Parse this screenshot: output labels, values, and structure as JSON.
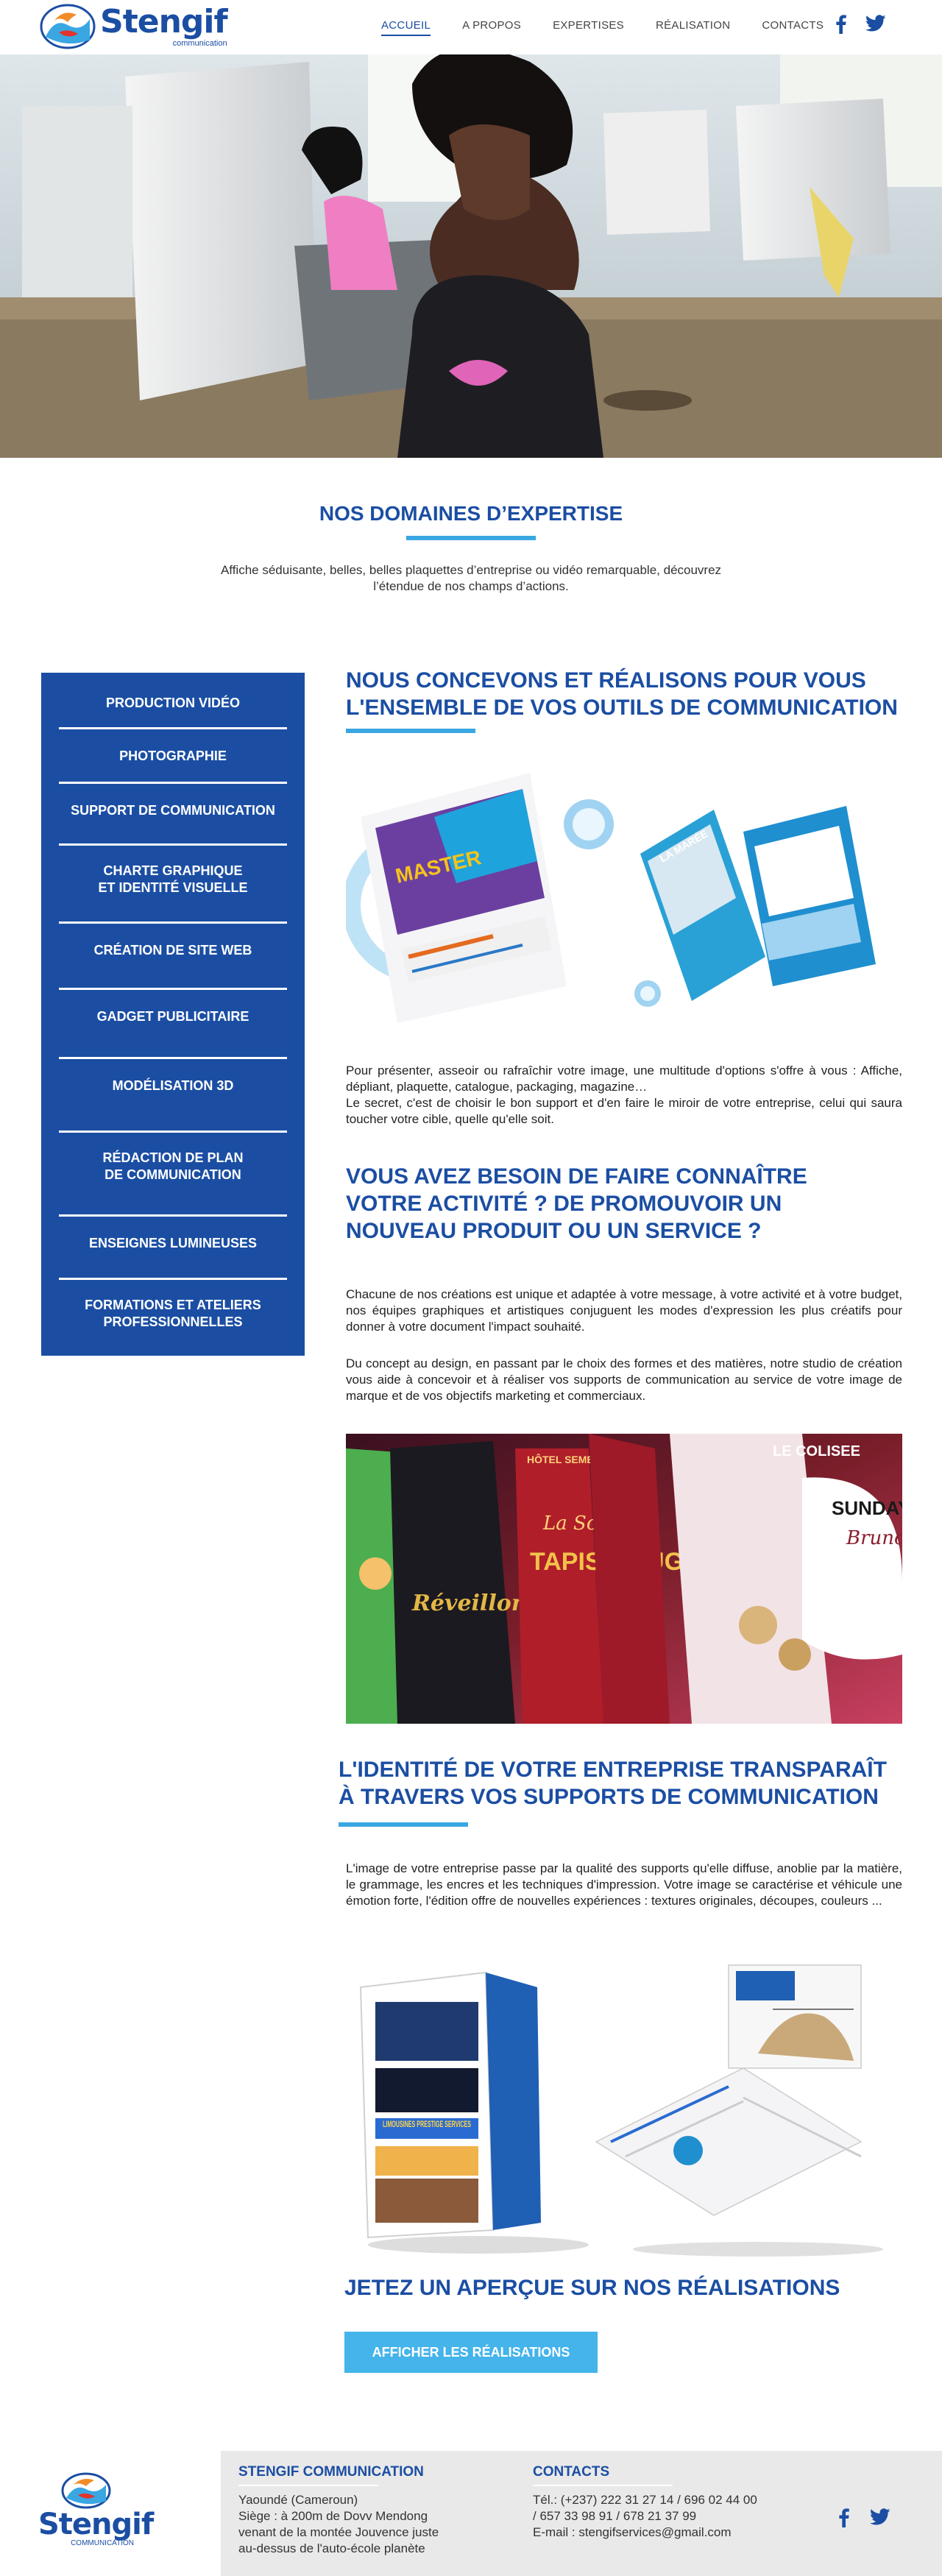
{
  "header": {
    "logo_name": "Stengif",
    "logo_sub": "communication",
    "nav": [
      {
        "label": "ACCUEIL",
        "active": true
      },
      {
        "label": "A PROPOS",
        "active": false
      },
      {
        "label": "EXPERTISES",
        "active": false
      },
      {
        "label": "RÉALISATION",
        "active": false
      },
      {
        "label": "CONTACTS",
        "active": false
      }
    ],
    "social": [
      "facebook-icon",
      "twitter-icon"
    ]
  },
  "expertise": {
    "title": "NOS DOMAINES D’EXPERTISE",
    "intro": "Affiche séduisante, belles, belles plaquettes d’entreprise ou vidéo remarquable, découvrez l’étendue de nos champs d’actions."
  },
  "sidebar": {
    "items": [
      "PRODUCTION VIDÉO",
      "PHOTOGRAPHIE",
      "SUPPORT DE COMMUNICATION",
      "CHARTE GRAPHIQUE\nET IDENTITÉ VISUELLE",
      "CRÉATION DE SITE WEB",
      "GADGET PUBLICITAIRE",
      "MODÉLISATION 3D",
      "RÉDACTION DE PLAN\nDE COMMUNICATION",
      "ENSEIGNES LUMINEUSES",
      "FORMATIONS ET ATELIERS\nPROFESSIONNELLES"
    ]
  },
  "content": {
    "h1": "NOUS CONCEVONS ET RÉALISONS POUR VOUS L'ENSEMBLE DE VOS OUTILS DE COMMUNICATION",
    "p1": "Pour présenter, asseoir ou rafraîchir votre image, une multitude d'options s'offre à vous : Affiche, dépliant, plaquette, catalogue, packaging, magazine…\nLe secret, c'est de choisir le bon support et d'en faire le miroir de votre entreprise, celui qui saura toucher votre cible, quelle qu'elle soit.",
    "h2": "VOUS AVEZ BESOIN DE FAIRE CONNAÎTRE VOTRE ACTIVITÉ ? DE PROMOUVOIR UN NOUVEAU PRODUIT OU UN SERVICE ?",
    "p2": "Chacune de nos créations est unique et adaptée à votre message, à votre activité et à votre budget, nos équipes graphiques et artistiques conjuguent les modes d'expression les plus créatifs pour donner à votre document l'impact souhaité.",
    "p3": "Du concept au design, en passant par le choix des formes et des matières, notre studio de création vous aide à concevoir et à réaliser vos supports de communication au service de votre image de marque et de vos objectifs marketing et commerciaux.",
    "h3": "L'IDENTITÉ DE VOTRE ENTREPRISE TRANSPARAÎT À TRAVERS VOS SUPPORTS DE COMMUNICATION",
    "p4": "L'image de votre entreprise passe par la qualité des supports qu'elle diffuse, anoblie par la matière, le grammage, les encres et les techniques d'impression. Votre image se caractérise et véhicule une émotion forte, l'édition offre de nouvelles expériences : textures originales, découpes, couleurs ...",
    "img1_texts": [
      "MASTER",
      "LA MARÉE"
    ],
    "img2_texts": [
      "La Soirée",
      "TAPIS ROUGE",
      "Réveillon",
      "SUNDAY",
      "Brunch",
      "HÔTEL SEME BEACH",
      "LE COLISEE"
    ],
    "img3_texts": [
      "LIMOUSINES PRESTIGE SERVICES"
    ],
    "cta_title": "JETEZ UN APERÇUE SUR NOS RÉALISATIONS",
    "cta_button": "AFFICHER LES RÉALISATIONS"
  },
  "footer": {
    "logo_name": "Stengif",
    "logo_sub": "COMMUNICATION",
    "company_title": "STENGIF COMMUNICATION",
    "company_lines": [
      "Yaoundé (Cameroun)",
      "Siège : à 200m de Dovv Mendong",
      "venant de la montée Jouvence juste",
      "au-dessus de l'auto-école planète"
    ],
    "contacts_title": "CONTACTS",
    "contacts_lines": [
      "Tél.: (+237) 222 31 27 14 / 696 02 44 00",
      "/ 657 33 98 91 / 678 21 37 99",
      "E-mail : stengifservices@gmail.com"
    ]
  },
  "colors": {
    "brand_blue": "#1b4ea3",
    "accent_blue": "#3aa7e2",
    "button_blue": "#44b4ea",
    "footer_bg": "#e9e9e9"
  }
}
